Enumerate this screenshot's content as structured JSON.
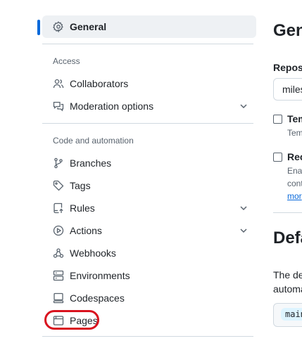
{
  "sidebar": {
    "general": {
      "label": "General",
      "icon": "gear-icon"
    },
    "groups": [
      {
        "heading": "Access",
        "items": [
          {
            "label": "Collaborators",
            "icon": "people-icon"
          },
          {
            "label": "Moderation options",
            "icon": "comment-discussion-icon",
            "expandable": true
          }
        ]
      },
      {
        "heading": "Code and automation",
        "items": [
          {
            "label": "Branches",
            "icon": "git-branch-icon"
          },
          {
            "label": "Tags",
            "icon": "tag-icon"
          },
          {
            "label": "Rules",
            "icon": "repo-push-icon",
            "expandable": true
          },
          {
            "label": "Actions",
            "icon": "play-icon",
            "expandable": true
          },
          {
            "label": "Webhooks",
            "icon": "webhook-icon"
          },
          {
            "label": "Environments",
            "icon": "server-icon"
          },
          {
            "label": "Codespaces",
            "icon": "codespaces-icon"
          },
          {
            "label": "Pages",
            "icon": "browser-icon"
          }
        ]
      }
    ]
  },
  "main": {
    "title": "Gen",
    "repo_label": "Reposi",
    "repo_value": "miles",
    "template_label": "Tem",
    "template_desc": "Tem",
    "require_label": "Rec",
    "require_desc_1": "Enab",
    "require_desc_2": "cont",
    "require_link": "mor",
    "default_branch_title": "Defa",
    "default_branch_para_1": "The de",
    "default_branch_para_2": "automa",
    "branch_value": "main"
  },
  "colors": {
    "accent": "#0969da",
    "annotation": "#d9131f",
    "active_bg": "#eef1f4"
  }
}
